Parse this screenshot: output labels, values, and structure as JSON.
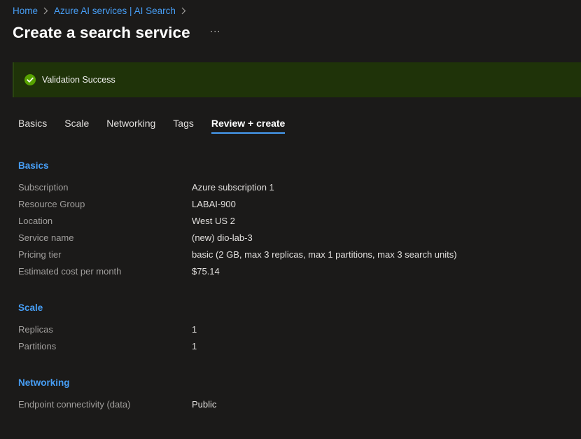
{
  "breadcrumb": {
    "items": [
      "Home",
      "Azure AI services | AI Search"
    ]
  },
  "header": {
    "title": "Create a search service",
    "more_label": "···"
  },
  "banner": {
    "text": "Validation Success",
    "color": "#57a300"
  },
  "tabs": [
    {
      "label": "Basics"
    },
    {
      "label": "Scale"
    },
    {
      "label": "Networking"
    },
    {
      "label": "Tags"
    },
    {
      "label": "Review + create",
      "active": true
    }
  ],
  "sections": {
    "basics": {
      "title": "Basics",
      "rows": [
        {
          "label": "Subscription",
          "value": "Azure subscription 1"
        },
        {
          "label": "Resource Group",
          "value": "LABAI-900"
        },
        {
          "label": "Location",
          "value": "West US 2"
        },
        {
          "label": "Service name",
          "value": "(new) dio-lab-3"
        },
        {
          "label": "Pricing tier",
          "value": "basic (2 GB, max 3 replicas, max 1 partitions, max 3 search units)"
        },
        {
          "label": "Estimated cost per month",
          "value": "$75.14"
        }
      ]
    },
    "scale": {
      "title": "Scale",
      "rows": [
        {
          "label": "Replicas",
          "value": "1"
        },
        {
          "label": "Partitions",
          "value": "1"
        }
      ]
    },
    "networking": {
      "title": "Networking",
      "rows": [
        {
          "label": "Endpoint connectivity (data)",
          "value": "Public"
        }
      ]
    }
  }
}
